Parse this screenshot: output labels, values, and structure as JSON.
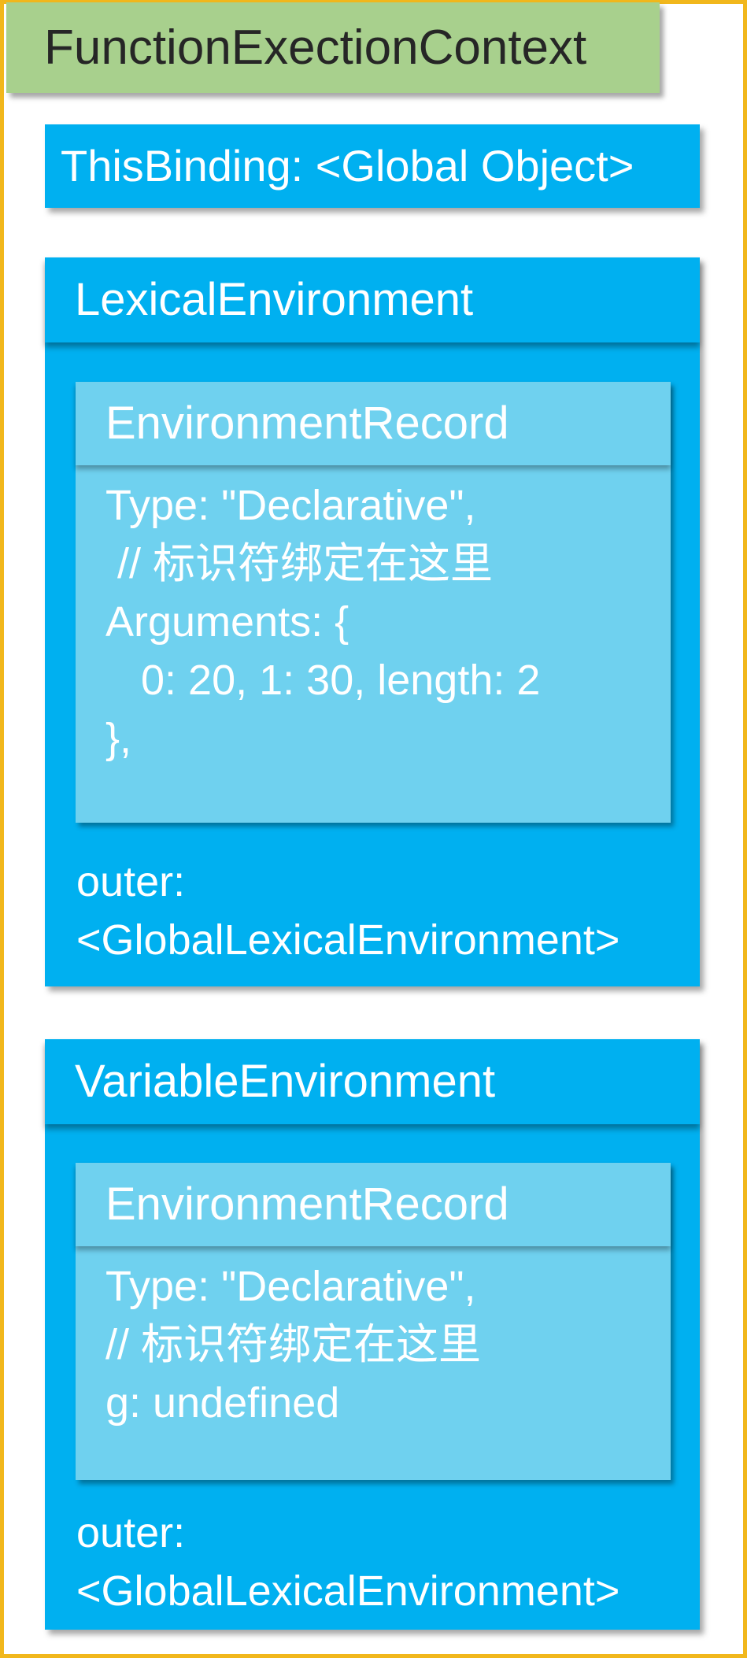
{
  "context": {
    "title": "FunctionExectionContext",
    "this_binding": "ThisBinding: <Global Object>"
  },
  "lexical_environment": {
    "label": "LexicalEnvironment",
    "record": {
      "label": "EnvironmentRecord",
      "lines": [
        "Type: \"Declarative\",",
        " // 标识符绑定在这里",
        "Arguments: {",
        "   0: 20, 1: 30, length: 2",
        "},"
      ]
    },
    "outer": [
      "outer:",
      "<GlobalLexicalEnvironment>"
    ]
  },
  "variable_environment": {
    "label": "VariableEnvironment",
    "record": {
      "label": "EnvironmentRecord",
      "lines": [
        "Type: \"Declarative\",",
        "// 标识符绑定在这里",
        "g: undefined"
      ]
    },
    "outer": [
      "outer:",
      "<GlobalLexicalEnvironment>"
    ]
  },
  "colors": {
    "title_bg": "#a8d08d",
    "frame_border": "#f1b71c",
    "env_blue": "#00b0f0",
    "record_blue": "#6fd1ef"
  }
}
